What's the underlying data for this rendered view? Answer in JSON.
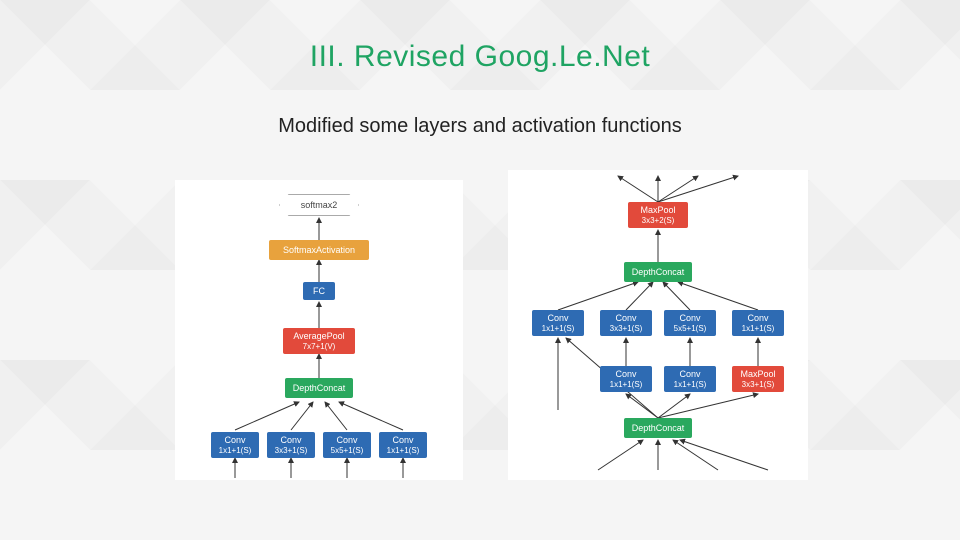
{
  "title": "III. Revised Goog.Le.Net",
  "subtitle": "Modified some layers and activation functions",
  "colors": {
    "blue": "#2e6bb3",
    "green": "#2aa85e",
    "red": "#e24a3b",
    "orange": "#e8a23d",
    "title": "#1fa463"
  },
  "left": {
    "softmax2": "softmax2",
    "softmax_activation": "SoftmaxActivation",
    "fc": "FC",
    "avgpool": {
      "l1": "AveragePool",
      "l2": "7x7+1(V)"
    },
    "depthconcat": "DepthConcat",
    "conv1": {
      "l1": "Conv",
      "l2": "1x1+1(S)"
    },
    "conv2": {
      "l1": "Conv",
      "l2": "3x3+1(S)"
    },
    "conv3": {
      "l1": "Conv",
      "l2": "5x5+1(S)"
    },
    "conv4": {
      "l1": "Conv",
      "l2": "1x1+1(S)"
    }
  },
  "right": {
    "maxpool_top": {
      "l1": "MaxPool",
      "l2": "3x3+2(S)"
    },
    "depthconcat_top": "DepthConcat",
    "r1": {
      "c1": {
        "l1": "Conv",
        "l2": "1x1+1(S)"
      },
      "c2": {
        "l1": "Conv",
        "l2": "3x3+1(S)"
      },
      "c3": {
        "l1": "Conv",
        "l2": "5x5+1(S)"
      },
      "c4": {
        "l1": "Conv",
        "l2": "1x1+1(S)"
      }
    },
    "r2": {
      "c2": {
        "l1": "Conv",
        "l2": "1x1+1(S)"
      },
      "c3": {
        "l1": "Conv",
        "l2": "1x1+1(S)"
      },
      "c4": {
        "l1": "MaxPool",
        "l2": "3x3+1(S)"
      }
    },
    "depthconcat_bottom": "DepthConcat"
  }
}
